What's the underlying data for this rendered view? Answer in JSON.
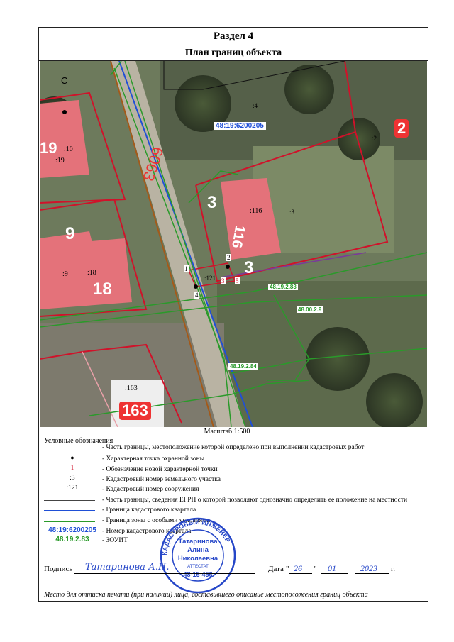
{
  "section_title": "Раздел 4",
  "plan_title": "План границ объекта",
  "map": {
    "north_label": "С",
    "quarter_label": "48:19:6200205",
    "parcel_labels": [
      ":19",
      ":10",
      ":9",
      ":18",
      ":116",
      ":121",
      ":163",
      ":3",
      ":2",
      ":4"
    ],
    "house_numbers": [
      "19",
      "9",
      "18",
      "3",
      "116",
      "3",
      "2",
      "163"
    ],
    "points": [
      "1",
      "2",
      "3",
      "4",
      "5"
    ],
    "zones": [
      "48.19.2.83",
      "48.00.2.9",
      "48.19.2.84"
    ],
    "road_number": "6063"
  },
  "scale": "Масштаб 1:500",
  "legend": {
    "title": "Условные обозначения",
    "items": [
      {
        "sym": "",
        "text": "- Часть границы, местоположение которой определено при выполнении кадастровых работ"
      },
      {
        "sym": "●",
        "text": "- Характерная точка охранной зоны"
      },
      {
        "sym": "1",
        "text": "- Обозначение новой характерной точки"
      },
      {
        "sym": ":3",
        "text": "- Кадастровый номер земельного участка"
      },
      {
        "sym": ":121",
        "text": "- Кадастровый номер сооружения"
      },
      {
        "sym": "",
        "text": "- Часть границы, сведения ЕГРН о которой позволяют однозначно определить ее положение на местности"
      },
      {
        "sym": "",
        "text": "- Граница кадастрового квартала"
      },
      {
        "sym": "",
        "text": "- Граница зоны с особыми условиями"
      },
      {
        "sym": "48:19:6200205",
        "text": "- Номер кадастрового квартала"
      },
      {
        "sym": "48.19.2.83",
        "text": "- ЗОУИТ"
      }
    ]
  },
  "signature": {
    "label": "Подпись",
    "handwritten": "Татаринова А.Н.",
    "date_label": "Дата",
    "day": "26",
    "month": "01",
    "year": "2023",
    "year_suffix": "г."
  },
  "stamp": {
    "name": "Татаринова Алина Николаевна",
    "attestat": "АТТЕСТАТ",
    "number": "48-15-456",
    "ring_text": "КАДАСТРОВЫЙ ИНЖЕНЕР"
  },
  "note": "Место для оттиска печати (при наличии) лица, составившего описание местоположения границ объекта",
  "colors": {
    "red": "#d0122a",
    "blue": "#1f4fd6",
    "green": "#2a9a2a",
    "pink": "#e8a0a8"
  }
}
